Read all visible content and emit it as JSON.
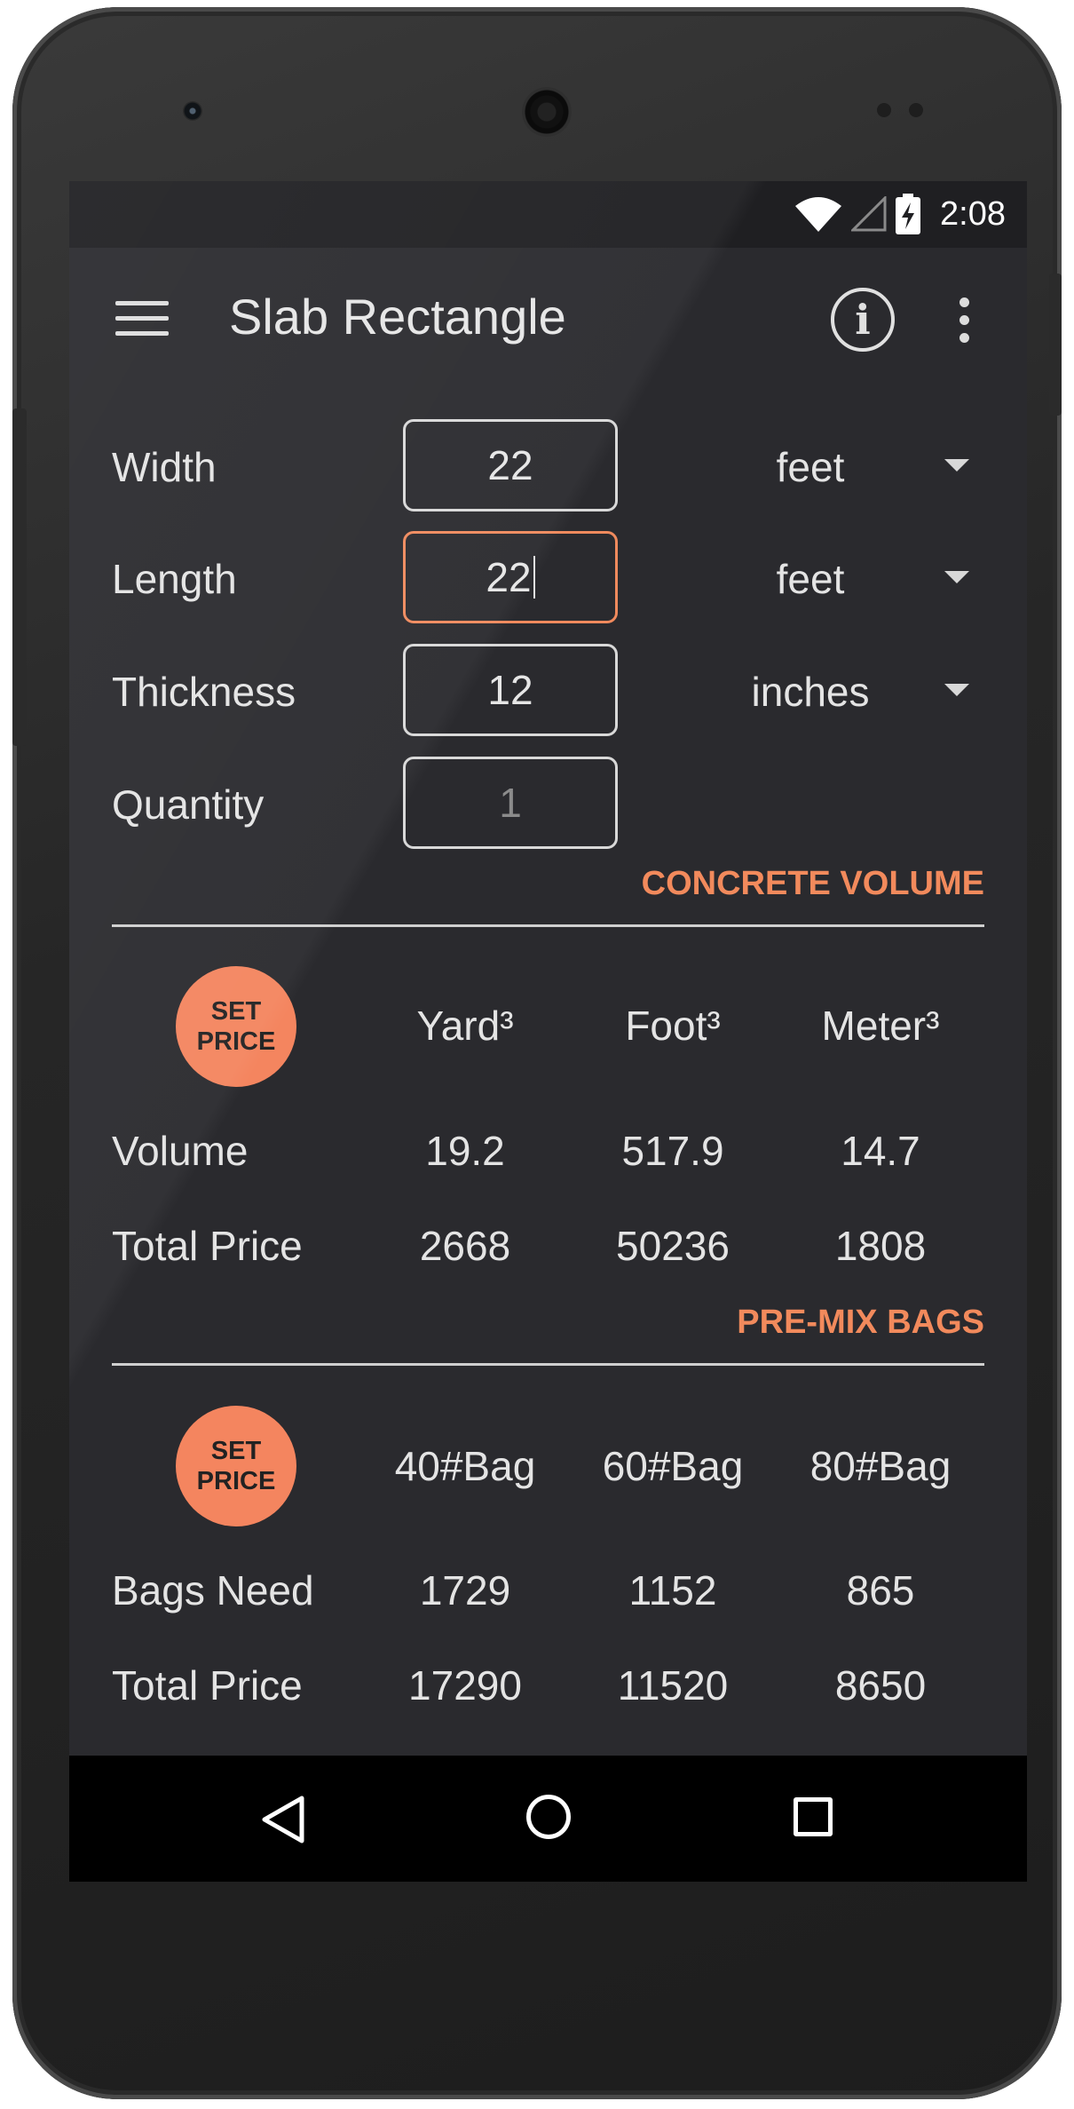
{
  "status_bar": {
    "time": "2:08"
  },
  "app_bar": {
    "title": "Slab Rectangle"
  },
  "inputs": [
    {
      "label": "Width",
      "value": "22",
      "unit": "feet"
    },
    {
      "label": "Length",
      "value": "22",
      "unit": "feet"
    },
    {
      "label": "Thickness",
      "value": "12",
      "unit": "inches"
    },
    {
      "label": "Quantity",
      "placeholder": "1"
    }
  ],
  "concrete_volume": {
    "section_title": "CONCRETE VOLUME",
    "set_price_label": "SET\nPRICE",
    "columns": [
      "Yard³",
      "Foot³",
      "Meter³"
    ],
    "rows": [
      {
        "label": "Volume",
        "values": [
          "19.2",
          "517.9",
          "14.7"
        ]
      },
      {
        "label": "Total Price",
        "values": [
          "2668",
          "50236",
          "1808"
        ]
      }
    ]
  },
  "pre_mix_bags": {
    "section_title": "PRE-MIX BAGS",
    "set_price_label": "SET\nPRICE",
    "columns": [
      "40#Bag",
      "60#Bag",
      "80#Bag"
    ],
    "rows": [
      {
        "label": "Bags Need",
        "values": [
          "1729",
          "1152",
          "865"
        ]
      },
      {
        "label": "Total Price",
        "values": [
          "17290",
          "11520",
          "8650"
        ]
      }
    ]
  },
  "colors": {
    "accent": "#f28a5c",
    "screen_bg": "#2a2a2e",
    "focused_border": "#f08a5d"
  },
  "icons": [
    "wifi-icon",
    "signal-icon",
    "battery-charging-icon",
    "menu-icon",
    "info-icon",
    "more-vert-icon",
    "dropdown-arrow-icon",
    "nav-back-icon",
    "nav-home-icon",
    "nav-recents-icon"
  ]
}
